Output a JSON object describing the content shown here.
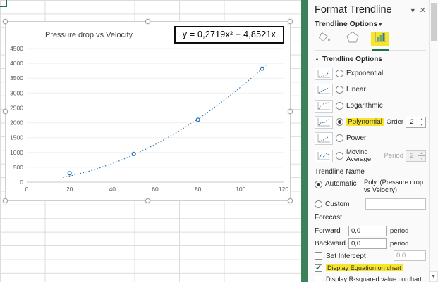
{
  "chart_data": {
    "type": "scatter",
    "title": "Pressure drop vs Velocity",
    "equation_label": "y = 0,2719x² + 4,8521x",
    "x": [
      20,
      50,
      80,
      110
    ],
    "y": [
      300,
      950,
      2100,
      3820
    ],
    "trendline": {
      "kind": "polynomial",
      "order": 2,
      "a": 0.2719,
      "b": 4.8521,
      "c": 0,
      "x_start": 17,
      "x_end": 112
    },
    "xlim": [
      0,
      120
    ],
    "ylim": [
      0,
      4500
    ],
    "x_ticks": [
      0,
      20,
      40,
      60,
      80,
      100,
      120
    ],
    "y_ticks": [
      0,
      500,
      1000,
      1500,
      2000,
      2500,
      3000,
      3500,
      4000,
      4500
    ],
    "marker_color": "#2e75b6",
    "trendline_color": "#2e75b6",
    "gridlines": true,
    "legend": "none"
  },
  "panel": {
    "title": "Format Trendline",
    "menu_glyph": "▼",
    "close_glyph": "✕",
    "options_heading": "Trendline Options",
    "options_caret": "▾",
    "section_collapse_glyph": "▲",
    "section_title": "Trendline Options",
    "types": [
      {
        "label": "Exponential",
        "selected": false
      },
      {
        "label": "Linear",
        "selected": false
      },
      {
        "label": "Logarithmic",
        "selected": false
      },
      {
        "label": "Polynomial",
        "selected": true,
        "highlighted": true
      },
      {
        "label": "Power",
        "selected": false
      },
      {
        "label": "Moving Average",
        "selected": false
      }
    ],
    "order_label": "Order",
    "order_value": "2",
    "period_label": "Period",
    "period_value": "2",
    "name_section": {
      "title": "Trendline Name",
      "automatic_label": "Automatic",
      "automatic_value": "Poly. (Pressure drop vs Velocity)",
      "custom_label": "Custom"
    },
    "forecast": {
      "title": "Forecast",
      "forward_label": "Forward",
      "forward_value": "0,0",
      "backward_label": "Backward",
      "backward_value": "0,0",
      "period_unit": "period"
    },
    "intercept": {
      "label": "Set Intercept",
      "value": "0,0",
      "checked": false
    },
    "display_equation": {
      "label": "Display Equation on chart",
      "checked": true
    },
    "display_r2": {
      "label": "Display R-squared value on chart",
      "checked": false
    }
  }
}
